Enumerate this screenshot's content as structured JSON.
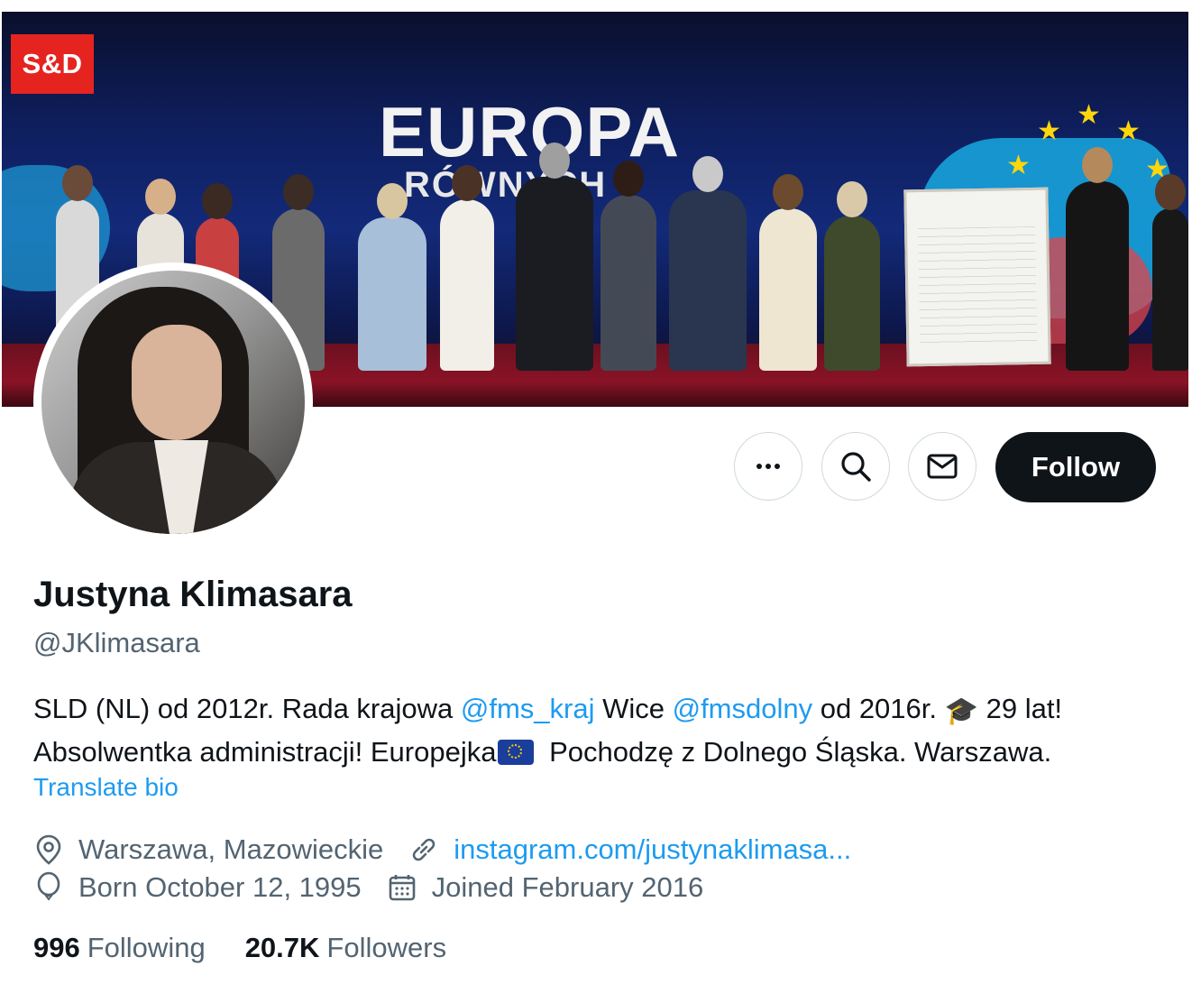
{
  "banner": {
    "logo_text": "S&D",
    "title": "EUROPA",
    "subtitle": "RÓWNYCH"
  },
  "profile": {
    "name": "Justyna Klimasara",
    "handle": "@JKlimasara",
    "bio": {
      "part1": "SLD (NL) od 2012r. Rada krajowa ",
      "mention1": "@fms_kraj",
      "part2": " Wice ",
      "mention2": "@fmsdolny",
      "part3": " od 2016r. ",
      "part4": " 29 lat!",
      "line2a": "Absolwentka administracji! Europejka",
      "line2b": " Pochodzę z Dolnego Śląska. Warszawa."
    },
    "translate_label": "Translate bio",
    "location": "Warszawa, Mazowieckie",
    "website": "instagram.com/justynaklimasa...",
    "birth": "Born October 12, 1995",
    "joined": "Joined February 2016"
  },
  "actions": {
    "more_icon": "more-icon",
    "search_icon": "search-icon",
    "message_icon": "mail-icon",
    "follow_label": "Follow"
  },
  "stats": {
    "following_count": "996",
    "following_label": "Following",
    "followers_count": "20.7K",
    "followers_label": "Followers"
  },
  "colors": {
    "accent": "#1d9bf0",
    "text": "#0f1419",
    "muted": "#536471",
    "button_dark": "#0f1419",
    "logo_red": "#e52420"
  }
}
